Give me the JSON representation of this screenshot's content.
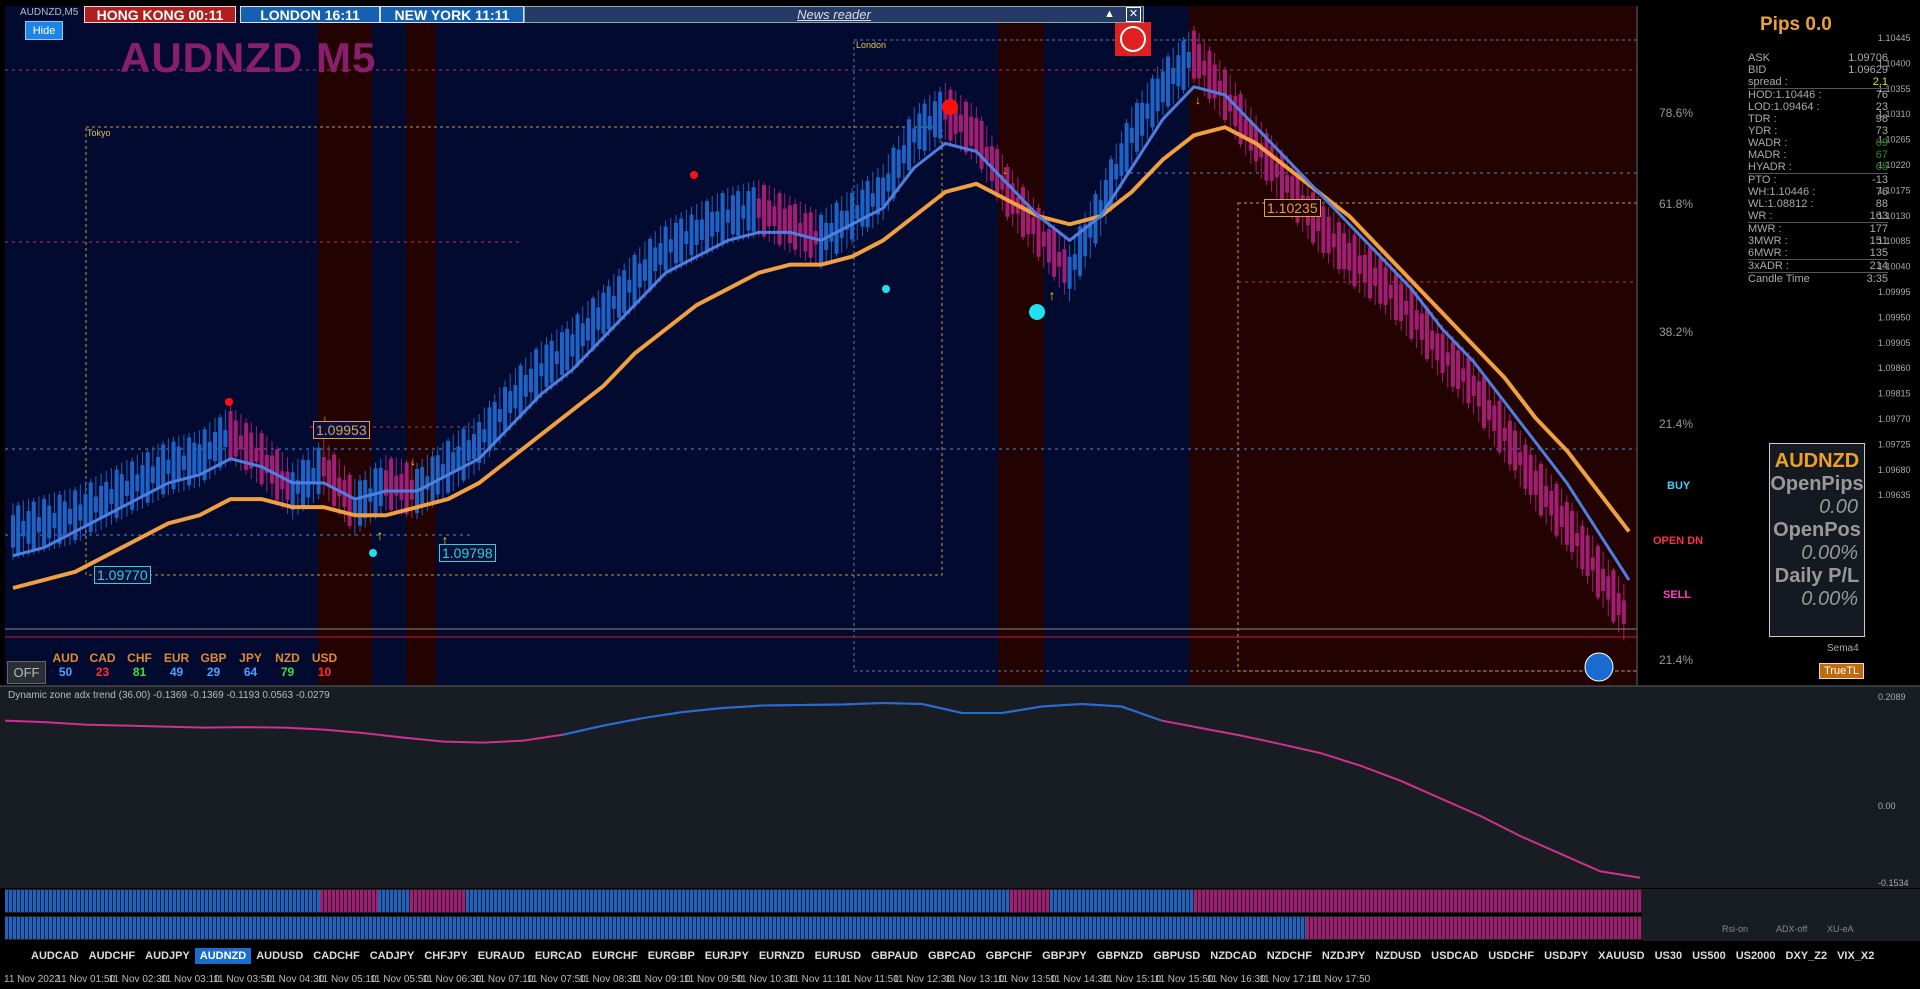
{
  "window_title": "AUDNZD,M5",
  "sessions": {
    "hongkong": "HONG KONG 00:11",
    "london": "LONDON  16:11",
    "newyork": "NEW YORK  11:11"
  },
  "news_reader": "News reader",
  "hide_button": "Hide",
  "symbol_title": "AUDNZD M5",
  "session_labels": {
    "tokyo": "Tokyo",
    "london": "London"
  },
  "price_labels": [
    "1.09953",
    "1.09770",
    "1.09798",
    "1.10235"
  ],
  "fib_labels": [
    "78.6%",
    "61.8%",
    "38.2%",
    "21.4%",
    "21.4%"
  ],
  "side_labels": {
    "buy": "BUY",
    "open": "OPEN  DN",
    "sell": "SELL",
    "sema": "Sema4",
    "truetl": "TrueTL"
  },
  "pips": "Pips 0.0",
  "stats": [
    [
      "ASK",
      "1.09706"
    ],
    [
      "BID",
      "1.09629"
    ],
    [
      "spread :",
      "2.1"
    ],
    [
      "HOD:1.10446 :",
      "76"
    ],
    [
      "LOD:1.09464 :",
      "23"
    ],
    [
      "TDR :",
      "98"
    ],
    [
      "YDR :",
      "73"
    ],
    [
      "WADR :",
      "69"
    ],
    [
      "MADR :",
      "67"
    ],
    [
      "HYADR :",
      "65"
    ],
    [
      "PTO :",
      "-13"
    ],
    [
      "WH:1.10446 :",
      "76"
    ],
    [
      "WL:1.08812 :",
      "88"
    ],
    [
      "WR :",
      "163"
    ],
    [
      "MWR :",
      "177"
    ],
    [
      "3MWR :",
      "151"
    ],
    [
      "6MWR :",
      "135"
    ],
    [
      "3xADR :",
      "214"
    ],
    [
      "Candle Time",
      "3:35"
    ]
  ],
  "panel": {
    "symbol": "AUDNZD",
    "open_pips_label": "OpenPips",
    "open_pips": "0.00",
    "open_pos_label": "OpenPos",
    "open_pos": "0.00%",
    "daily_label": "Daily P/L",
    "daily": "0.00%"
  },
  "currencies": [
    {
      "name": "AUD",
      "value": "50",
      "color": "#4aa3ff"
    },
    {
      "name": "CAD",
      "value": "23",
      "color": "#ff3030"
    },
    {
      "name": "CHF",
      "value": "81",
      "color": "#3be03b"
    },
    {
      "name": "EUR",
      "value": "49",
      "color": "#4aa3ff"
    },
    {
      "name": "GBP",
      "value": "29",
      "color": "#4aa3ff"
    },
    {
      "name": "JPY",
      "value": "64",
      "color": "#4aa3ff"
    },
    {
      "name": "NZD",
      "value": "79",
      "color": "#3be03b"
    },
    {
      "name": "USD",
      "value": "10",
      "color": "#ff3030"
    }
  ],
  "off_button": "OFF",
  "indicator_label": "Dynamic zone adx trend (36.00) -0.1369 -0.1369 -0.1193 0.0563 -0.0279",
  "indicator_axis": [
    "0.2089",
    "0.00",
    "-0.1534"
  ],
  "bottom_labels": [
    "Rsi-on",
    "ADX-off",
    "XU-eA"
  ],
  "symbol_tabs": [
    "AUDCAD",
    "AUDCHF",
    "AUDJPY",
    "AUDNZD",
    "AUDUSD",
    "CADCHF",
    "CADJPY",
    "CHFJPY",
    "EURAUD",
    "EURCAD",
    "EURCHF",
    "EURGBP",
    "EURJPY",
    "EURNZD",
    "EURUSD",
    "GBPAUD",
    "GBPCAD",
    "GBPCHF",
    "GBPJPY",
    "GBPNZD",
    "GBPUSD",
    "NZDCAD",
    "NZDCHF",
    "NZDJPY",
    "NZDUSD",
    "USDCAD",
    "USDCHF",
    "USDJPY",
    "XAUUSD",
    "US30",
    "US500",
    "US2000",
    "DXY_Z2",
    "VIX_X2"
  ],
  "active_tab": "AUDNZD",
  "colors": {
    "bg_blue": "#030a30",
    "bg_red": "#230202",
    "bull": "#1d62c4",
    "bear": "#a31d74",
    "ma_orange": "#f0a040",
    "ma_blue": "#4d7fe0",
    "ind_line_pink": "#d0308f",
    "ind_line_blue": "#1f6fd6"
  },
  "chart_data": {
    "type": "line",
    "title": "AUDNZD M5",
    "price_axis": [
      "1.10445",
      "1.10400",
      "1.10355",
      "1.10310",
      "1.10265",
      "1.10220",
      "1.10175",
      "1.10130",
      "1.10085",
      "1.10040",
      "1.09995",
      "1.09950",
      "1.09905",
      "1.09860",
      "1.09815",
      "1.09770",
      "1.09725",
      "1.09680",
      "1.09635"
    ],
    "time_axis": [
      "11 Nov 2022",
      "11 Nov 01:50",
      "11 Nov 02:30",
      "11 Nov 03:10",
      "11 Nov 03:50",
      "11 Nov 04:30",
      "11 Nov 05:10",
      "11 Nov 05:50",
      "11 Nov 06:30",
      "11 Nov 07:10",
      "11 Nov 07:50",
      "11 Nov 08:30",
      "11 Nov 09:10",
      "11 Nov 09:50",
      "11 Nov 10:30",
      "11 Nov 11:10",
      "11 Nov 11:50",
      "11 Nov 12:30",
      "11 Nov 13:10",
      "11 Nov 13:50",
      "11 Nov 14:30",
      "11 Nov 15:10",
      "11 Nov 15:50",
      "11 Nov 16:30",
      "11 Nov 17:10",
      "11 Nov 17:50"
    ],
    "ylim": [
      1.0962,
      1.1046
    ],
    "series": [
      {
        "name": "close",
        "values": [
          1.0981,
          1.0982,
          1.0983,
          1.0985,
          1.0987,
          1.0989,
          1.099,
          1.0993,
          1.099,
          1.0986,
          1.0989,
          1.0984,
          1.0987,
          1.0986,
          1.0989,
          1.0992,
          1.0997,
          1.1001,
          1.1004,
          1.1008,
          1.1012,
          1.1016,
          1.1018,
          1.102,
          1.1021,
          1.1019,
          1.1017,
          1.102,
          1.1023,
          1.103,
          1.1033,
          1.103,
          1.1023,
          1.1018,
          1.1013,
          1.1021,
          1.103,
          1.1036,
          1.104,
          1.1035,
          1.1029,
          1.1024,
          1.1019,
          1.1015,
          1.1012,
          1.1008,
          1.1003,
          1.0999,
          1.0993,
          1.0987,
          1.0982,
          1.0976,
          1.097
        ]
      },
      {
        "name": "ma_fast",
        "values": [
          1.0978,
          1.0979,
          1.0981,
          1.0983,
          1.0985,
          1.0987,
          1.0988,
          1.099,
          1.0989,
          1.0987,
          1.0987,
          1.0985,
          1.0986,
          1.0986,
          1.0988,
          1.099,
          1.0994,
          1.0998,
          1.1001,
          1.1005,
          1.1009,
          1.1013,
          1.1015,
          1.1017,
          1.1018,
          1.1018,
          1.1017,
          1.1019,
          1.1021,
          1.1026,
          1.1029,
          1.1028,
          1.1024,
          1.102,
          1.1017,
          1.102,
          1.1026,
          1.1032,
          1.1036,
          1.1035,
          1.1031,
          1.1027,
          1.1023,
          1.1019,
          1.1015,
          1.1011,
          1.1006,
          1.1002,
          1.0997,
          1.0992,
          1.0987,
          1.0981,
          1.0975
        ]
      },
      {
        "name": "ma_slow",
        "values": [
          1.0974,
          1.0975,
          1.0976,
          1.0978,
          1.098,
          1.0982,
          1.0983,
          1.0985,
          1.0985,
          1.0984,
          1.0984,
          1.0983,
          1.0983,
          1.0984,
          1.0985,
          1.0987,
          1.099,
          1.0993,
          1.0996,
          1.0999,
          1.1003,
          1.1006,
          1.1009,
          1.1011,
          1.1013,
          1.1014,
          1.1014,
          1.1015,
          1.1017,
          1.102,
          1.1023,
          1.1024,
          1.1022,
          1.102,
          1.1019,
          1.102,
          1.1023,
          1.1027,
          1.103,
          1.1031,
          1.1029,
          1.1026,
          1.1023,
          1.102,
          1.1016,
          1.1012,
          1.1008,
          1.1004,
          1.1,
          1.0995,
          1.0991,
          1.0986,
          1.0981
        ]
      }
    ],
    "indicator": {
      "name": "Dynamic zone adx trend",
      "values": [
        0.16,
        0.157,
        0.152,
        0.15,
        0.148,
        0.146,
        0.147,
        0.146,
        0.142,
        0.135,
        0.126,
        0.118,
        0.116,
        0.12,
        0.132,
        0.15,
        0.165,
        0.177,
        0.185,
        0.19,
        0.191,
        0.192,
        0.195,
        0.193,
        0.175,
        0.175,
        0.188,
        0.193,
        0.188,
        0.16,
        0.145,
        0.13,
        0.113,
        0.095,
        0.07,
        0.04,
        0.005,
        -0.03,
        -0.07,
        -0.105,
        -0.14,
        -0.153
      ]
    }
  }
}
